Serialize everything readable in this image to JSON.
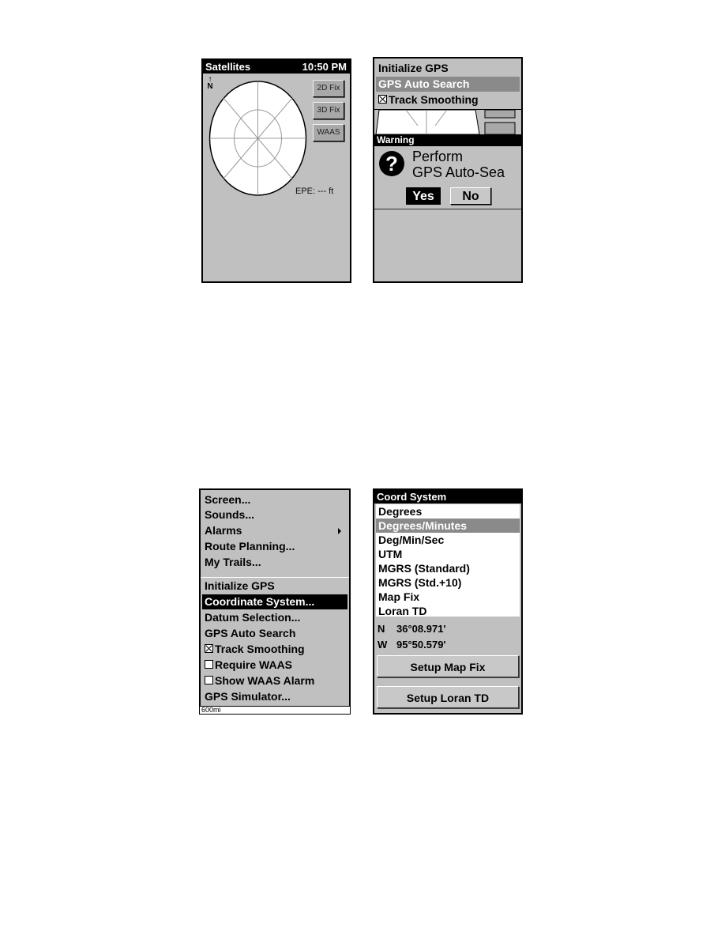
{
  "satellites_screen": {
    "title": "Satellites",
    "time": "10:50 PM",
    "north_label": "N",
    "buttons": [
      "2D Fix",
      "3D Fix",
      "WAAS"
    ],
    "epe": "EPE:  ---  ft"
  },
  "warning_screen": {
    "menu_items": [
      {
        "label": "Initialize GPS",
        "state": "normal"
      },
      {
        "label": "GPS Auto Search",
        "state": "highlighted"
      },
      {
        "label": "Track Smoothing",
        "state": "checked"
      }
    ],
    "dialog_title": "Warning",
    "message_line1": "Perform",
    "message_line2": "GPS Auto-Sea",
    "yes_label": "Yes",
    "no_label": "No"
  },
  "gps_menu_screen": {
    "items": [
      {
        "label": "Screen..."
      },
      {
        "label": "Sounds..."
      },
      {
        "label": "Alarms",
        "submenu": true
      },
      {
        "label": "Route Planning..."
      },
      {
        "label": "My Trails..."
      },
      {
        "label": "Initialize GPS"
      },
      {
        "label": "Coordinate System...",
        "selected": true
      },
      {
        "label": "Datum Selection..."
      },
      {
        "label": "GPS Auto Search"
      },
      {
        "label": "Track Smoothing",
        "checkbox": true,
        "checked": true
      },
      {
        "label": "Require WAAS",
        "checkbox": true,
        "checked": false
      },
      {
        "label": "Show WAAS Alarm",
        "checkbox": true,
        "checked": false
      },
      {
        "label": "GPS Simulator..."
      }
    ],
    "scale_label": "600mi"
  },
  "coord_system_screen": {
    "title": "Coord System",
    "options": [
      {
        "label": "Degrees"
      },
      {
        "label": "Degrees/Minutes",
        "highlighted": true
      },
      {
        "label": "Deg/Min/Sec"
      },
      {
        "label": "UTM"
      },
      {
        "label": "MGRS (Standard)"
      },
      {
        "label": "MGRS (Std.+10)"
      },
      {
        "label": "Map Fix"
      },
      {
        "label": "Loran TD"
      }
    ],
    "lat_label": "N",
    "lat_value": "36°08.971'",
    "lon_label": "W",
    "lon_value": "95°50.579'",
    "setup_map_fix_label": "Setup Map Fix",
    "setup_loran_label": "Setup Loran TD"
  }
}
